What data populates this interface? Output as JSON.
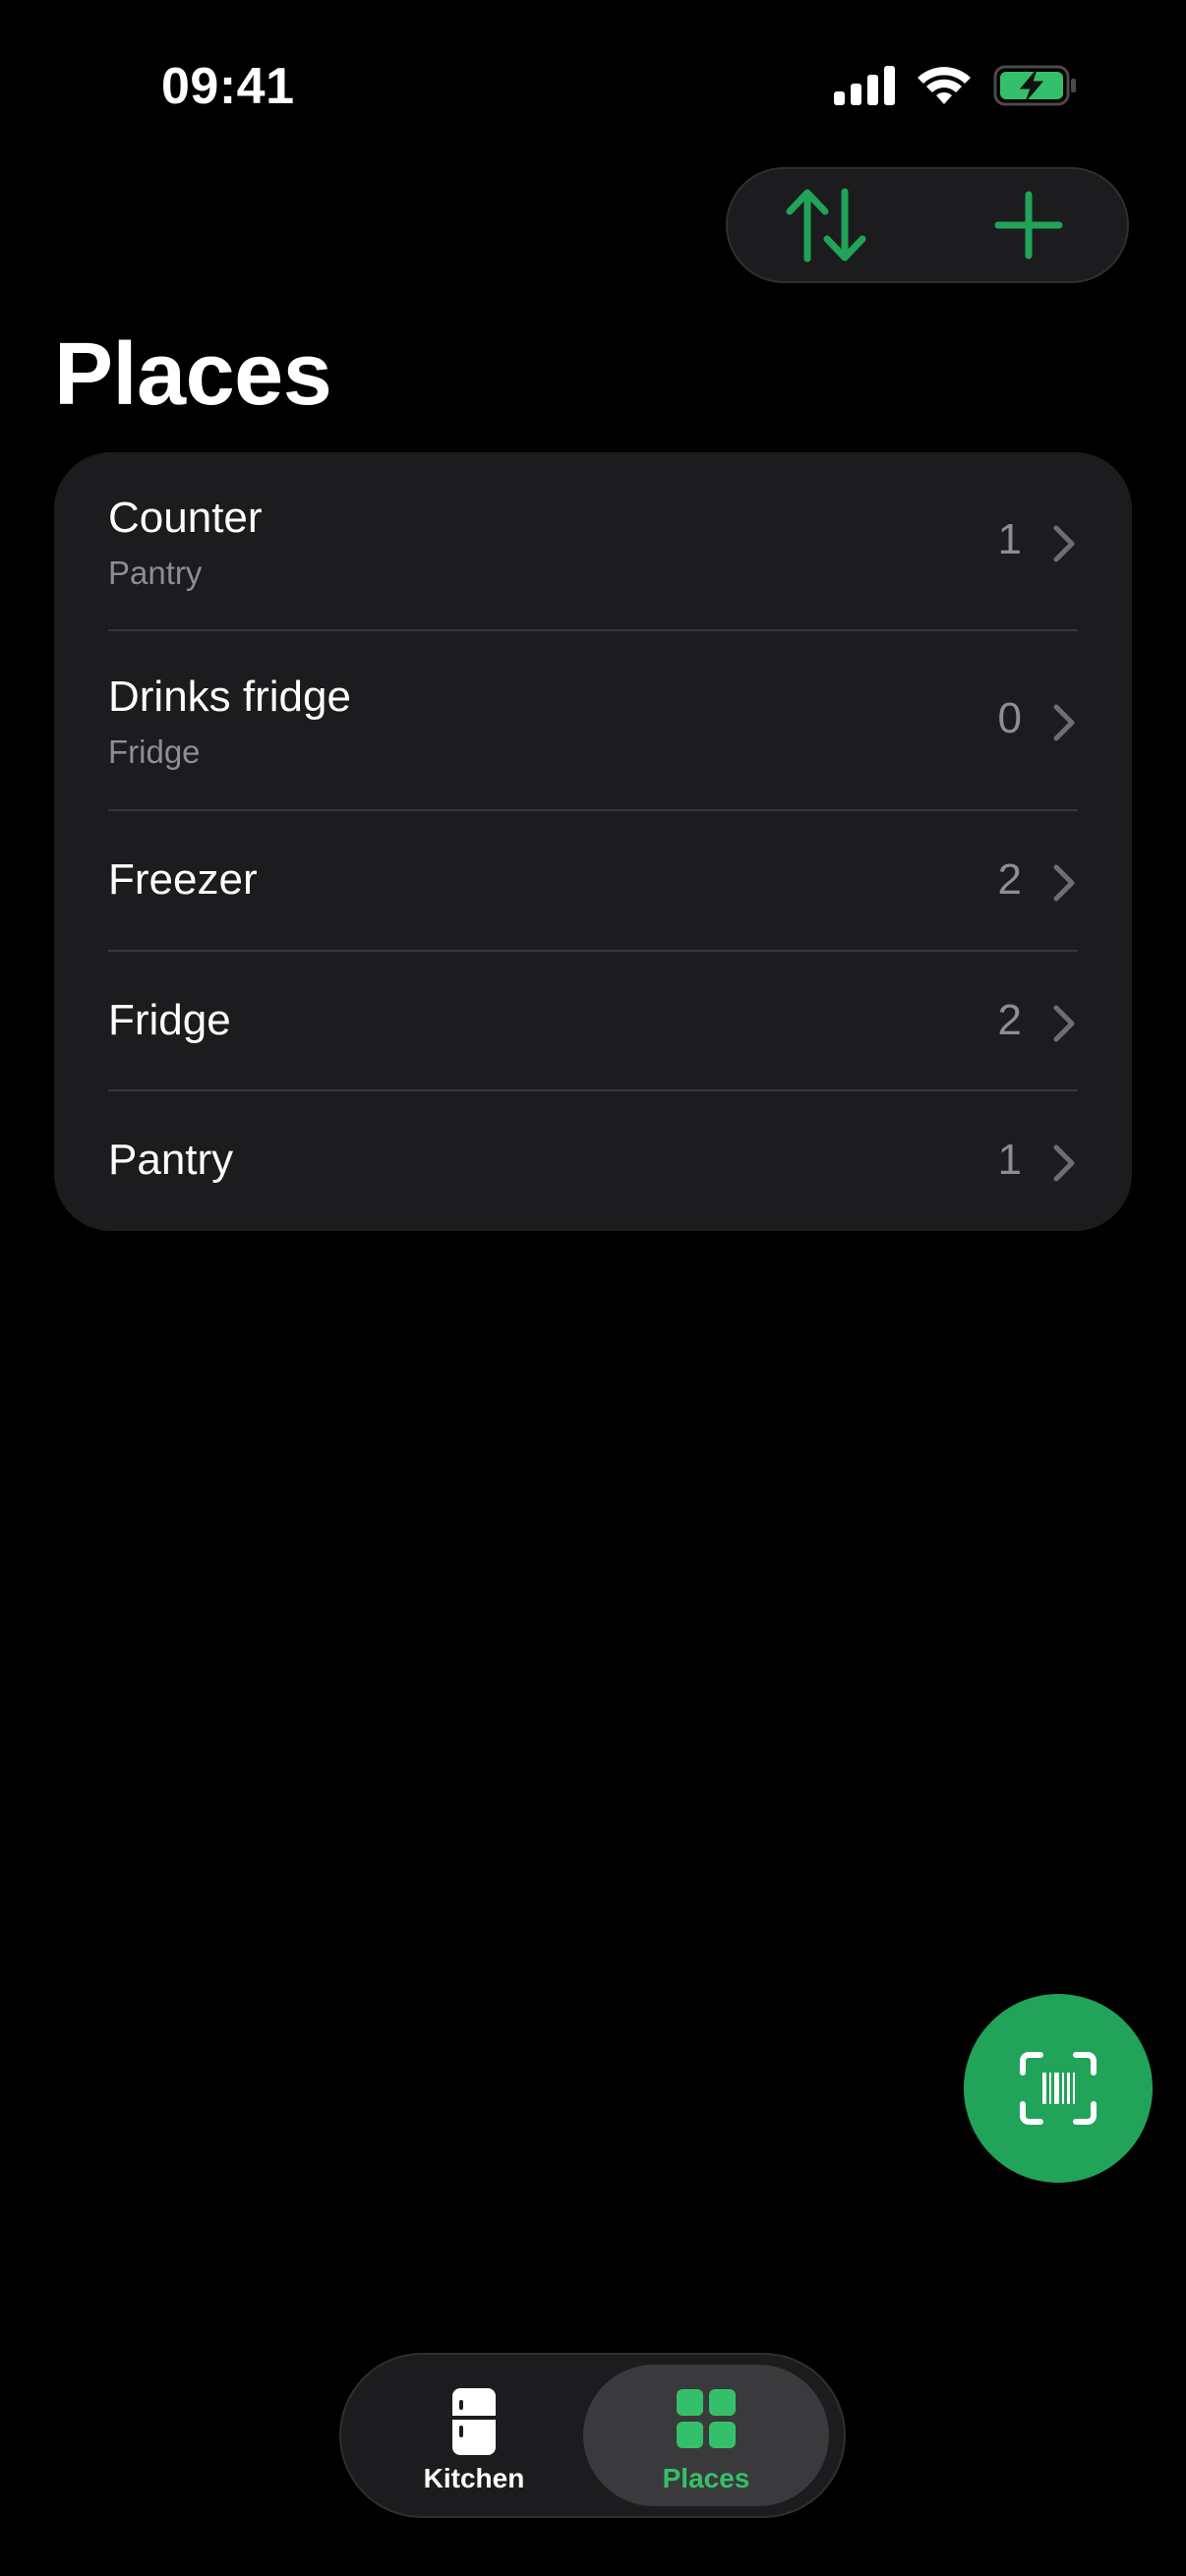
{
  "status_bar": {
    "time": "09:41"
  },
  "colors": {
    "accent": "#21a35a",
    "accent_light": "#34c06a",
    "background": "#000000",
    "card": "#1c1c1e",
    "secondary_text": "#8d8d92"
  },
  "toolbar": {
    "sort_icon": "arrow-up-down-icon",
    "add_icon": "plus-icon"
  },
  "page": {
    "title": "Places"
  },
  "places": [
    {
      "name": "Counter",
      "type": "Pantry",
      "count": "1"
    },
    {
      "name": "Drinks fridge",
      "type": "Fridge",
      "count": "0"
    },
    {
      "name": "Freezer",
      "type": "",
      "count": "2"
    },
    {
      "name": "Fridge",
      "type": "",
      "count": "2"
    },
    {
      "name": "Pantry",
      "type": "",
      "count": "1"
    }
  ],
  "scan_button": {
    "icon": "barcode-scan-icon"
  },
  "tab_bar": {
    "tabs": [
      {
        "label": "Kitchen",
        "icon": "fridge-icon",
        "selected": false
      },
      {
        "label": "Places",
        "icon": "grid-icon",
        "selected": true
      }
    ]
  }
}
